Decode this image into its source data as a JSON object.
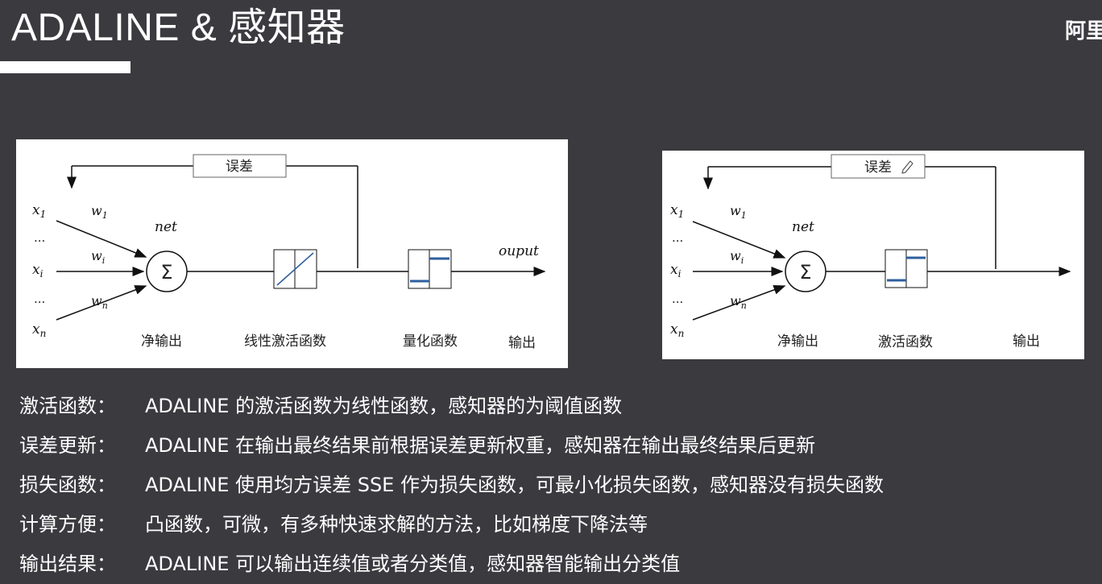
{
  "title": "ADALINE & 感知器",
  "corner_text": "阿里",
  "adaline_diagram": {
    "error_label": "误差",
    "inputs": [
      "x1",
      "...",
      "xi",
      "...",
      "xn"
    ],
    "weights": [
      "w1",
      "wi",
      "wn"
    ],
    "net_label": "net",
    "sum_symbol": "Σ",
    "output_label": "ouput",
    "captions": {
      "net_output": "净输出",
      "activation": "线性激活函数",
      "quantizer": "量化函数",
      "output": "输出"
    }
  },
  "perceptron_diagram": {
    "error_label": "误差",
    "inputs": [
      "x1",
      "...",
      "xi",
      "...",
      "xn"
    ],
    "weights": [
      "w1",
      "wi",
      "wn"
    ],
    "net_label": "net",
    "sum_symbol": "Σ",
    "captions": {
      "net_output": "净输出",
      "activation": "激活函数",
      "output": "输出"
    }
  },
  "notes": [
    {
      "key": "激活函数：",
      "text": "ADALINE 的激活函数为线性函数，感知器的为阈值函数"
    },
    {
      "key": "误差更新：",
      "text": "ADALINE 在输出最终结果前根据误差更新权重，感知器在输出最终结果后更新"
    },
    {
      "key": "损失函数：",
      "text": "ADALINE 使用均方误差 SSE 作为损失函数，可最小化损失函数，感知器没有损失函数"
    },
    {
      "key": "计算方便：",
      "text": "凸函数，可微，有多种快速求解的方法，比如梯度下降法等"
    },
    {
      "key": "输出结果：",
      "text": "ADALINE 可以输出连续值或者分类值，感知器智能输出分类值"
    }
  ],
  "colors": {
    "background": "#3a3a3f",
    "step_blue": "#2e5f9e"
  }
}
